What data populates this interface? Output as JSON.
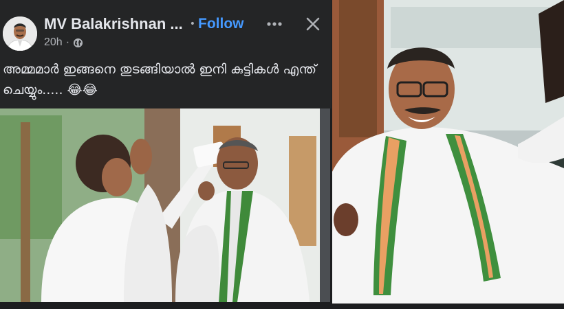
{
  "post": {
    "author": "MV Balakrishnan ...",
    "dot": "•",
    "follow_label": "Follow",
    "timestamp": "20h",
    "meta_separator": "·",
    "text": "അമ്മമാർ ഇങ്ങനെ തുടങ്ങിയാൽ ഇനി കുട്ടികൾ എന്ത് ചെയ്യും..... 😂😂"
  },
  "icons": {
    "avatar": "profile-avatar",
    "more": "more-options-icon",
    "close": "close-icon",
    "audience": "globe-icon"
  },
  "colors": {
    "header_bg": "#242526",
    "follow": "#4599ff",
    "text": "#e4e6eb",
    "meta": "#b0b3b8"
  }
}
